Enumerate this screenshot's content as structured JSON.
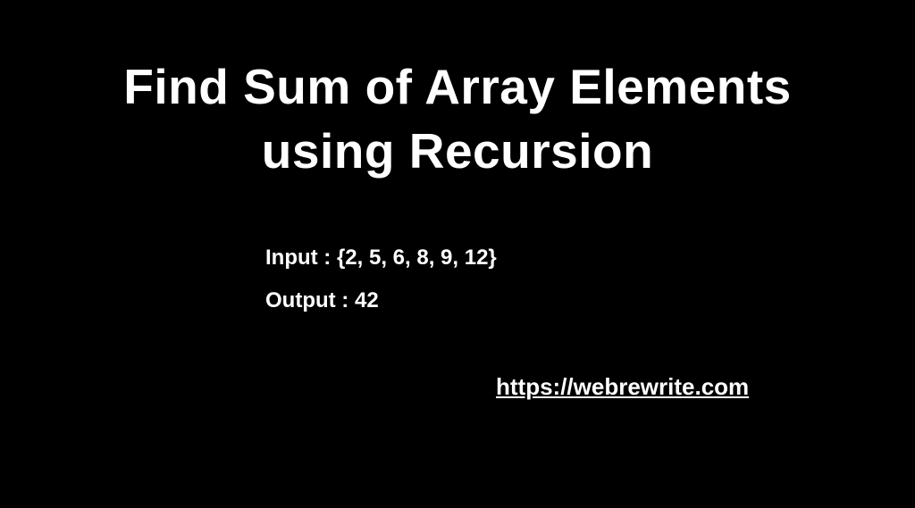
{
  "title_line1": "Find Sum of Array Elements",
  "title_line2": "using Recursion",
  "example": {
    "input_label": "Input : ",
    "input_value": "{2, 5, 6, 8, 9, 12}",
    "output_label": "Output : ",
    "output_value": "42"
  },
  "source_url": "https://webrewrite.com"
}
